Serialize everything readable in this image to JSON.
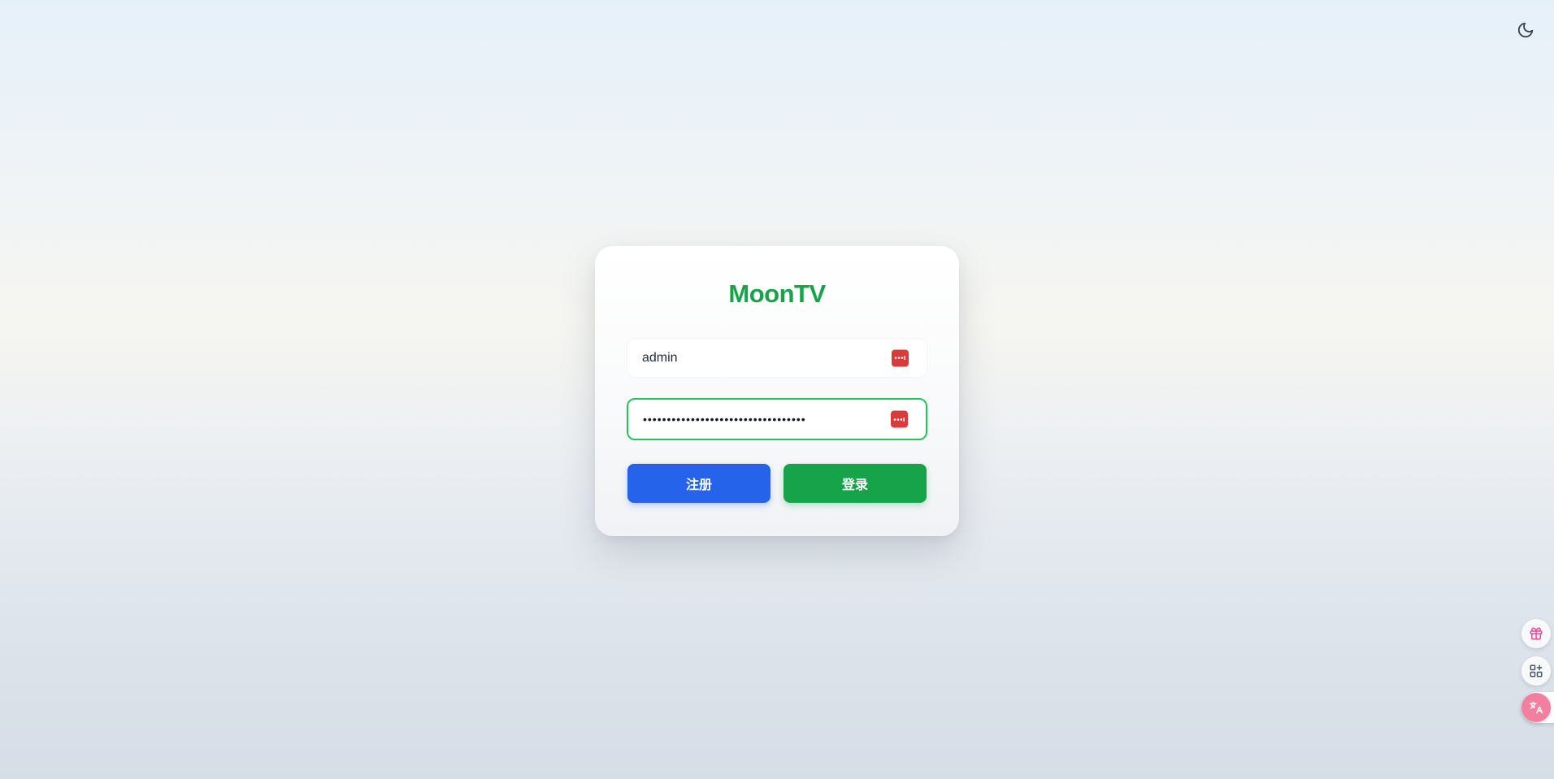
{
  "theme_toggle": {
    "icon": "moon-icon"
  },
  "login": {
    "title": "MoonTV",
    "username": {
      "value": "admin",
      "manager_icon": "password-manager-icon"
    },
    "password": {
      "masked_value": "••••••••••••••••••••••••••••••••••",
      "manager_icon": "password-manager-icon"
    },
    "register_label": "注册",
    "login_label": "登录"
  },
  "floating_tools": [
    {
      "icon": "gift-icon"
    },
    {
      "icon": "apps-add-icon"
    },
    {
      "icon": "translate-icon"
    }
  ],
  "colors": {
    "brand_green": "#16a34a",
    "register_blue": "#2563eb",
    "focus_border": "#22c55e",
    "manager_red": "#d93b3b"
  }
}
